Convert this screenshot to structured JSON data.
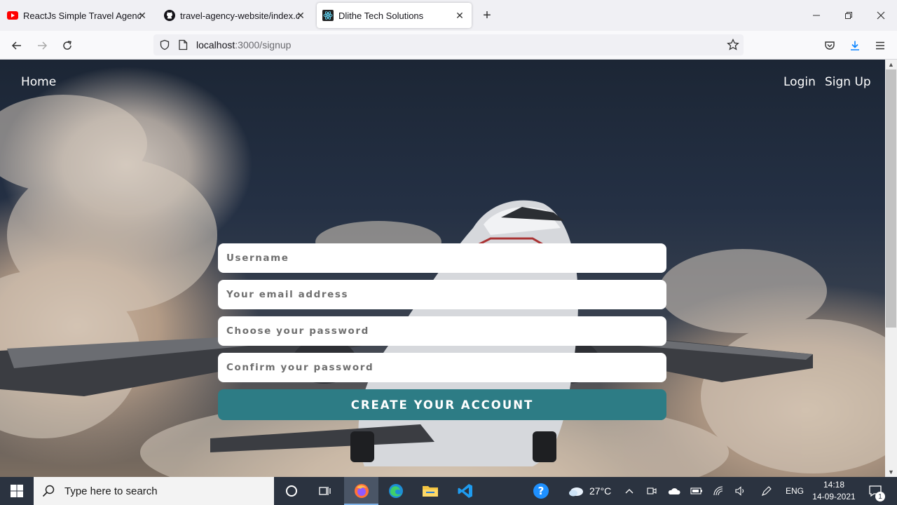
{
  "browser": {
    "tabs": [
      {
        "title": "ReactJs Simple Travel Agency La",
        "icon": "youtube-icon",
        "active": false
      },
      {
        "title": "travel-agency-website/index.cs",
        "icon": "github-icon",
        "active": false
      },
      {
        "title": "Dlithe Tech Solutions",
        "icon": "react-icon",
        "active": true
      }
    ],
    "url_host": "localhost",
    "url_path": ":3000/signup"
  },
  "site": {
    "nav_home": "Home",
    "nav_login": "Login",
    "nav_signup": "Sign Up"
  },
  "form": {
    "username_placeholder": "Username",
    "email_placeholder": "Your email address",
    "password_placeholder": "Choose your password",
    "confirm_placeholder": "Confirm your password",
    "submit_label": "CREATE YOUR ACCOUNT"
  },
  "taskbar": {
    "search_placeholder": "Type here to search",
    "weather": "27°C",
    "language": "ENG",
    "time": "14:18",
    "date": "14-09-2021",
    "notification_count": "1"
  },
  "colors": {
    "accent_button": "#2d7c85",
    "taskbar": "#2b3340"
  }
}
